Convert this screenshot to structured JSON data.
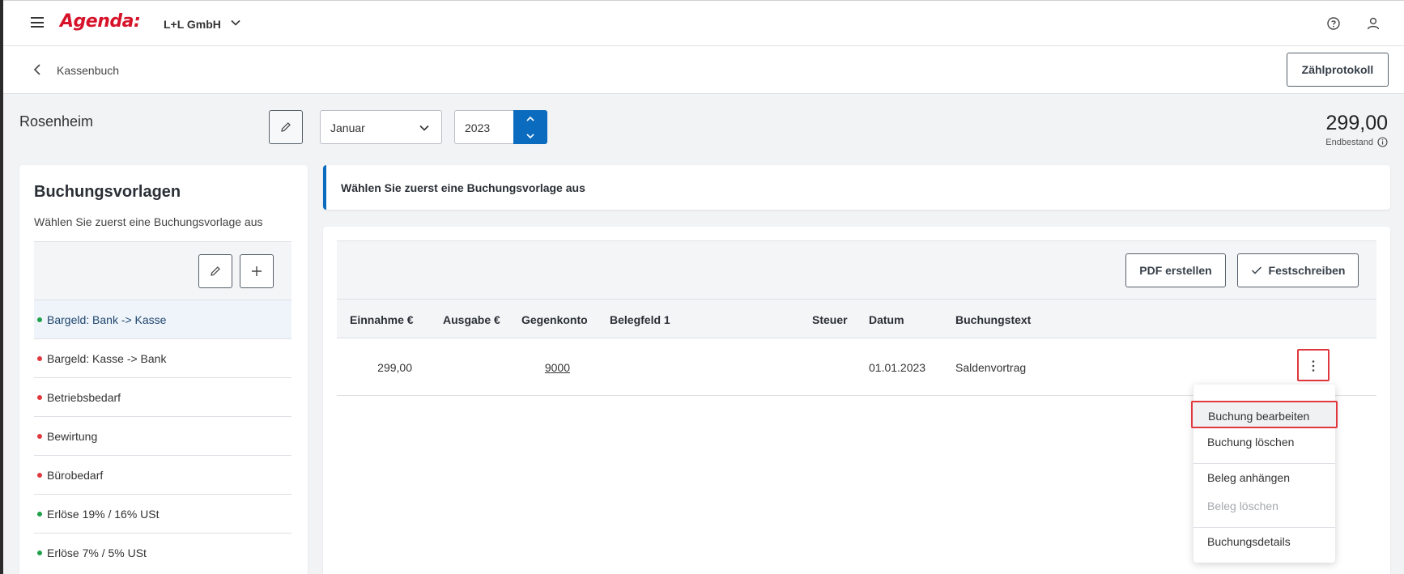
{
  "app": {
    "logo": "Agenda:",
    "company": "L+L GmbH"
  },
  "subbar": {
    "back_label": "Kassenbuch",
    "zaehlprotokoll": "Zählprotokoll"
  },
  "header": {
    "location": "Rosenheim",
    "month": "Januar",
    "year": "2023",
    "balance": "299,00",
    "balance_label": "Endbestand"
  },
  "templates": {
    "title": "Buchungsvorlagen",
    "subtitle": "Wählen Sie zuerst eine Buchungsvorlage aus",
    "items": [
      {
        "label": "Bargeld: Bank -> Kasse",
        "status": "green"
      },
      {
        "label": "Bargeld: Kasse -> Bank",
        "status": "red"
      },
      {
        "label": "Betriebsbedarf",
        "status": "red"
      },
      {
        "label": "Bewirtung",
        "status": "red"
      },
      {
        "label": "Bürobedarf",
        "status": "red"
      },
      {
        "label": "Erlöse 19% / 16% USt",
        "status": "green"
      },
      {
        "label": "Erlöse 7% / 5% USt",
        "status": "green"
      }
    ]
  },
  "info": {
    "message": "Wählen Sie zuerst eine Buchungsvorlage aus"
  },
  "toolbar": {
    "pdf": "PDF erstellen",
    "festschreiben": "Festschreiben"
  },
  "table": {
    "headers": {
      "einnahme": "Einnahme €",
      "ausgabe": "Ausgabe €",
      "gegenkonto": "Gegenkonto",
      "belegfeld": "Belegfeld 1",
      "steuer": "Steuer",
      "datum": "Datum",
      "buchungstext": "Buchungstext"
    },
    "rows": [
      {
        "einnahme": "299,00",
        "ausgabe": "",
        "gegenkonto": "9000",
        "belegfeld": "",
        "steuer": "",
        "datum": "01.01.2023",
        "buchungstext": "Saldenvortrag"
      }
    ]
  },
  "context_menu": {
    "items": [
      {
        "label": "Buchung bearbeiten",
        "highlighted": true,
        "disabled": false
      },
      {
        "label": "Buchung löschen",
        "highlighted": false,
        "disabled": false
      },
      {
        "label": "Beleg anhängen",
        "highlighted": false,
        "disabled": false
      },
      {
        "label": "Beleg löschen",
        "highlighted": false,
        "disabled": true
      },
      {
        "label": "Buchungsdetails",
        "highlighted": false,
        "disabled": false
      }
    ]
  },
  "colors": {
    "brand": "#d6132a",
    "accent": "#0b6cbf",
    "status_green": "#1fa14a",
    "status_red": "#e0383e",
    "highlight_outline": "#e0383e"
  },
  "icons": [
    "menu-icon",
    "chevron-down-icon",
    "help-icon",
    "user-icon",
    "chevron-left-icon",
    "pencil-icon",
    "plus-icon",
    "check-icon",
    "info-icon",
    "kebab-icon",
    "chevron-up-icon"
  ]
}
